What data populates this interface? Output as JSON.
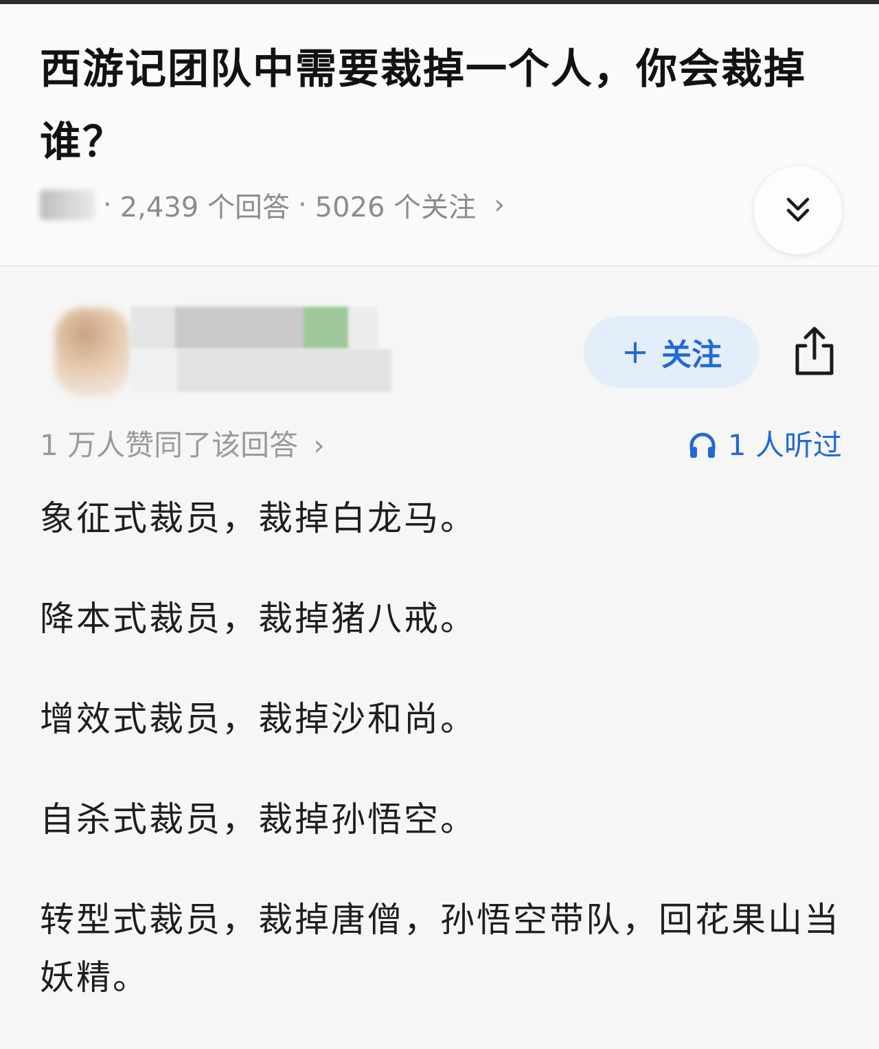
{
  "question": {
    "title": "西游记团队中需要裁掉一个人，你会裁掉谁？",
    "source": "知乎",
    "answer_count": "2,439 个回答",
    "follower_count": "5026 个关注",
    "separator": "·",
    "chevron": "›"
  },
  "author": {
    "name": "",
    "follow_label": "关注"
  },
  "stats": {
    "agree_text": "1 万人赞同了该回答",
    "listen_text": "1 人听过"
  },
  "answer": {
    "paragraphs": [
      "象征式裁员，裁掉白龙马。",
      "降本式裁员，裁掉猪八戒。",
      "增效式裁员，裁掉沙和尚。",
      "自杀式裁员，裁掉孙悟空。",
      "转型式裁员，裁掉唐僧，孙悟空带队，回花果山当妖精。"
    ]
  },
  "icons": {
    "collapse": "double-chevron-down-icon",
    "share": "share-icon",
    "listen": "headphones-icon"
  },
  "colors": {
    "accent": "#1f6ad6",
    "follow_bg": "#e4edfa",
    "meta_text": "#8c8c8c",
    "background": "#f6f6f6"
  }
}
